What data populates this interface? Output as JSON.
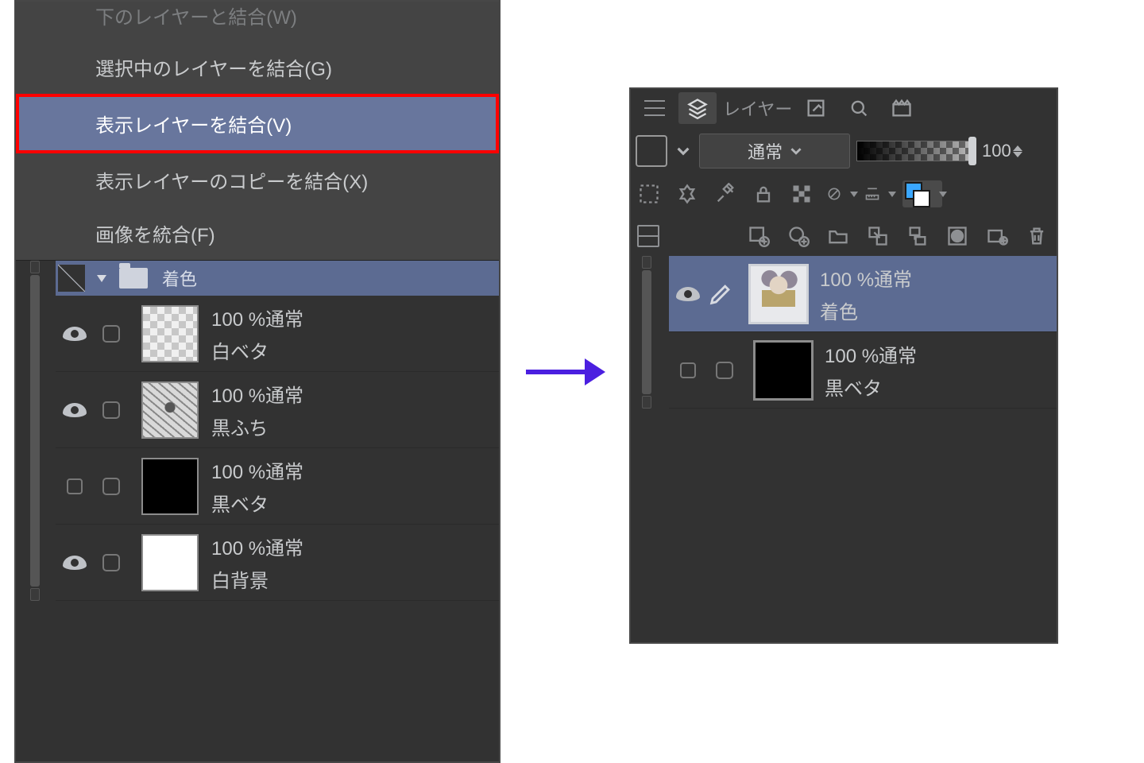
{
  "menu": {
    "items": [
      {
        "label": "下のレイヤーと結合(W)",
        "dim": true,
        "short": true
      },
      {
        "label": "選択中のレイヤーを結合(G)"
      },
      {
        "label": "表示レイヤーを結合(V)",
        "highlighted": true
      },
      {
        "label": "表示レイヤーのコピーを結合(X)"
      },
      {
        "label": "画像を統合(F)"
      }
    ]
  },
  "leftPanel": {
    "folder": {
      "name": "着色"
    },
    "layers": [
      {
        "opacity": "100 %通常",
        "name": "白ベタ",
        "thumb": "checker",
        "visible": true
      },
      {
        "opacity": "100 %通常",
        "name": "黒ふち",
        "thumb": "linework",
        "visible": true
      },
      {
        "opacity": "100 %通常",
        "name": "黒ベタ",
        "thumb": "black",
        "visible": false
      },
      {
        "opacity": "100 %通常",
        "name": "白背景",
        "thumb": "white",
        "visible": true
      }
    ]
  },
  "rightPanel": {
    "tabLabel": "レイヤー",
    "blendMode": "通常",
    "opacity": "100",
    "layers": [
      {
        "opacity": "100 %通常",
        "name": "着色",
        "thumb": "char",
        "selected": true,
        "visible": true
      },
      {
        "opacity": "100 %通常",
        "name": "黒ベタ",
        "thumb": "black",
        "selected": false,
        "visible": false
      }
    ]
  }
}
